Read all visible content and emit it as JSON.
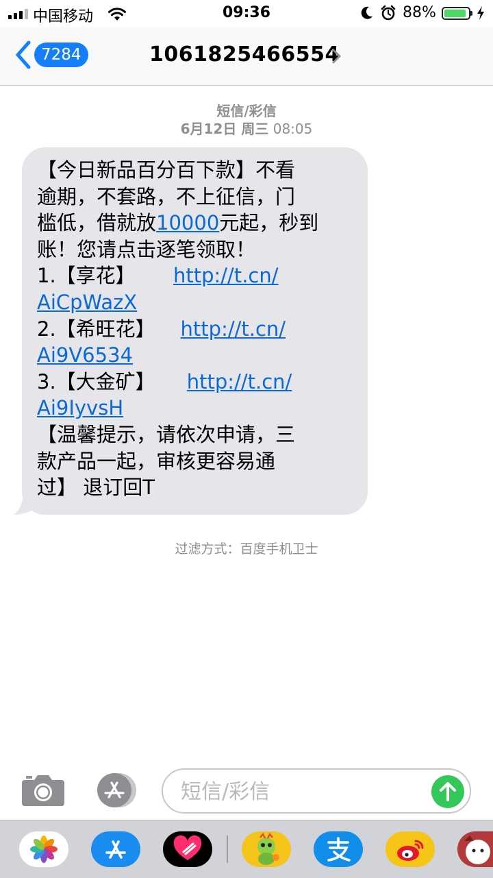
{
  "status_bar": {
    "carrier": "中国移动",
    "time": "09:36",
    "battery_percent": "88%",
    "battery_level": 0.88,
    "icons": [
      "signal-icon",
      "wifi-icon",
      "moon-icon",
      "alarm-icon",
      "battery-icon",
      "charging-icon"
    ]
  },
  "nav": {
    "back_badge": "7284",
    "title": "1061825466554"
  },
  "message": {
    "type": "短信/彩信",
    "date": "6月12日 周三",
    "time": "08:05",
    "lines": [
      {
        "text": "【今日新品百分百下款】不看"
      },
      {
        "text": "逾期，不套路，不上征信，门"
      },
      {
        "pre": "槛低，借就放",
        "link": "10000",
        "post": "元起，秒到"
      },
      {
        "text": "账！您请点击逐笔领取！"
      },
      {
        "pre": "1.【享花】      ",
        "link": "http://t.cn/"
      },
      {
        "link": "AiCpWazX"
      },
      {
        "pre": "2.【希旺花】    ",
        "link": "http://t.cn/"
      },
      {
        "link": "Ai9V6534"
      },
      {
        "pre": "3.【大金矿】     ",
        "link": "http://t.cn/"
      },
      {
        "link": "Ai9IyvsH"
      },
      {
        "text": "【温馨提示，请依次申请，三"
      },
      {
        "text": "款产品一起，审核更容易通"
      },
      {
        "text": "过】 退订回T"
      }
    ]
  },
  "filter_text": "过滤方式：百度手机卫士",
  "input": {
    "placeholder": "短信/彩信"
  },
  "drawer_apps": [
    "photos-app-icon",
    "app-store-app-icon",
    "digital-touch-app-icon",
    "dragon-sticker-app-icon",
    "alipay-app-icon",
    "weibo-app-icon",
    "cartoon-sticker-app-icon"
  ],
  "colors": {
    "accent": "#147efb",
    "bubble": "#e5e5ea",
    "link": "#0a69d8",
    "send": "#34c759",
    "meta_text": "#8e8e93"
  }
}
